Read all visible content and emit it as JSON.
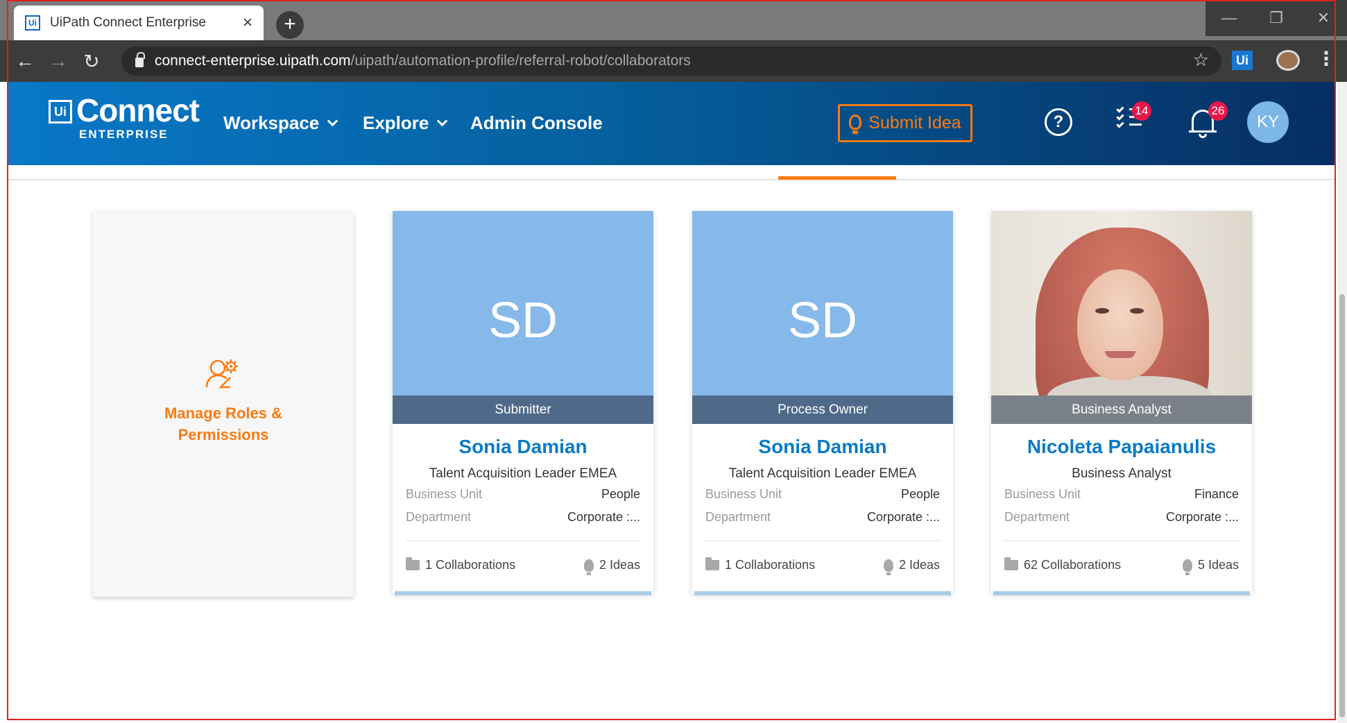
{
  "browser": {
    "tab_title": "UiPath Connect Enterprise",
    "tab_favicon": "Ui",
    "url_host": "connect-enterprise.uipath.com",
    "url_path": "/uipath/automation-profile/referral-robot/collaborators",
    "extension_label": "Ui"
  },
  "app": {
    "logo_mark": "Ui",
    "logo_text": "Connect",
    "logo_sub": "ENTERPRISE",
    "nav": [
      {
        "label": "Workspace"
      },
      {
        "label": "Explore"
      },
      {
        "label": "Admin Console"
      }
    ],
    "submit_idea_label": "Submit Idea",
    "help_symbol": "?",
    "tasks_badge": "14",
    "notifications_badge": "26",
    "avatar_initials": "KY",
    "accent": "#fa7a10"
  },
  "manage_card": {
    "label": "Manage Roles &\nPermissions",
    "icon": "user-gear-icon"
  },
  "collaborators": [
    {
      "initials": "SD",
      "role": "Submitter",
      "name": "Sonia Damian",
      "title": "Talent Acquisition Leader EMEA",
      "business_unit_label": "Business Unit",
      "business_unit": "People",
      "department_label": "Department",
      "department": "Corporate :...",
      "collaborations": "1 Collaborations",
      "ideas": "2 Ideas"
    },
    {
      "initials": "SD",
      "role": "Process Owner",
      "name": "Sonia Damian",
      "title": "Talent Acquisition Leader EMEA",
      "business_unit_label": "Business Unit",
      "business_unit": "People",
      "department_label": "Department",
      "department": "Corporate :...",
      "collaborations": "1 Collaborations",
      "ideas": "2 Ideas"
    },
    {
      "initials": "",
      "role": "Business Analyst",
      "name": "Nicoleta Papaianulis",
      "title": "Business Analyst",
      "business_unit_label": "Business Unit",
      "business_unit": "Finance",
      "department_label": "Department",
      "department": "Corporate :...",
      "collaborations": "62 Collaborations",
      "ideas": "5 Ideas"
    }
  ]
}
